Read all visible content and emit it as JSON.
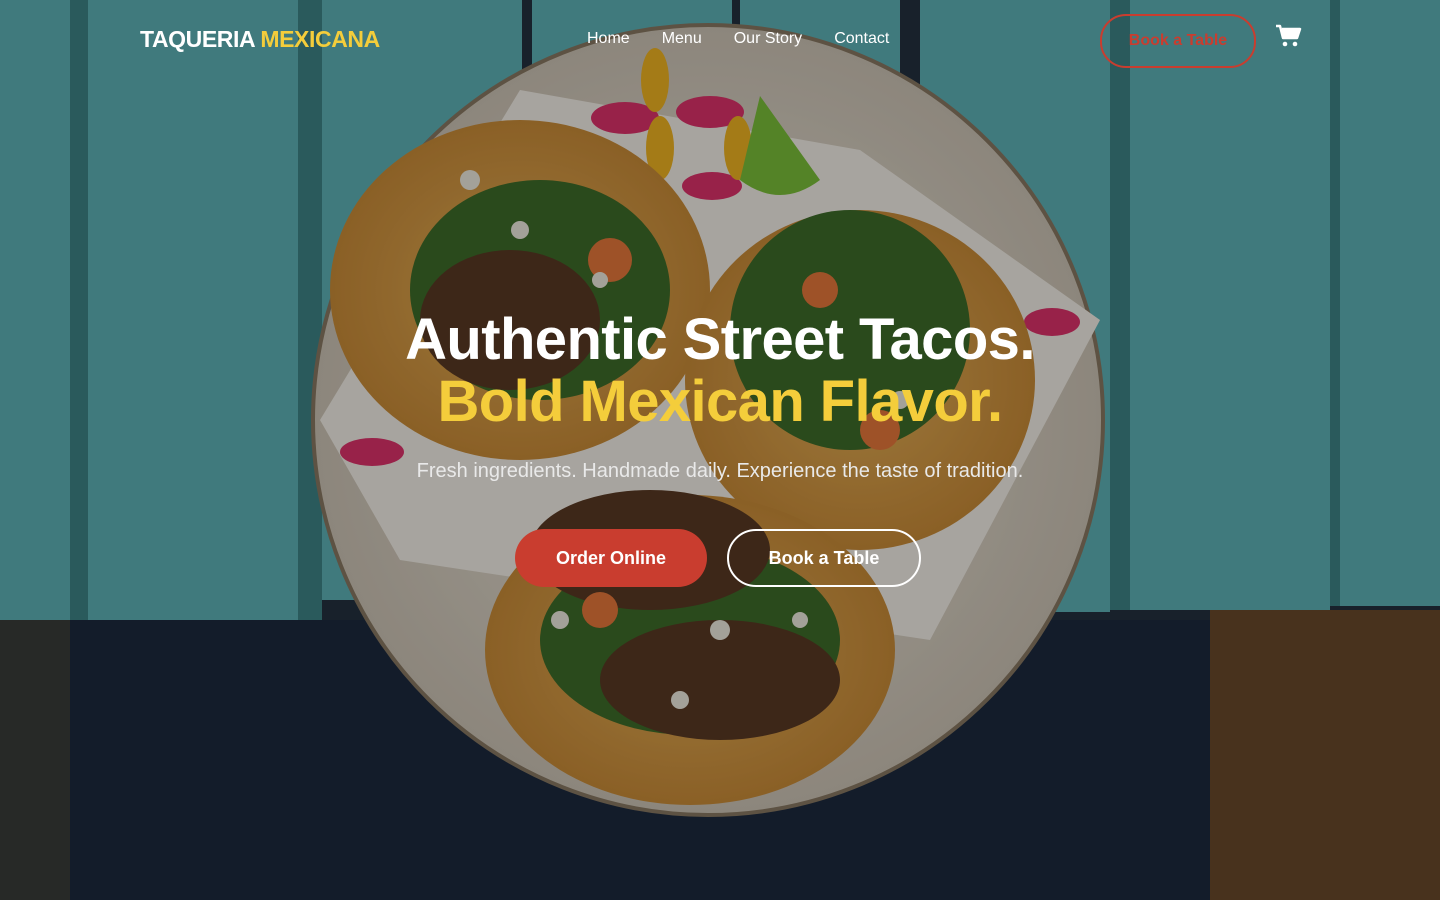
{
  "brand": {
    "part1": "TAQUERIA",
    "part2": "MEXICANA"
  },
  "nav": {
    "links": [
      "Home",
      "Menu",
      "Our Story",
      "Contact"
    ],
    "book_label": "Book a Table"
  },
  "hero": {
    "line1": "Authentic Street Tacos.",
    "line2": "Bold Mexican Flavor.",
    "subtitle": "Fresh ingredients. Handmade daily. Experience the taste of tradition.",
    "primary_cta": "Order Online",
    "secondary_cta": "Book a Table"
  },
  "icons": {
    "cart": "shopping-cart-icon"
  },
  "colors": {
    "accent_yellow": "#f4cd3b",
    "accent_red": "#c93d2f",
    "table_teal": "#5fb4b8"
  }
}
